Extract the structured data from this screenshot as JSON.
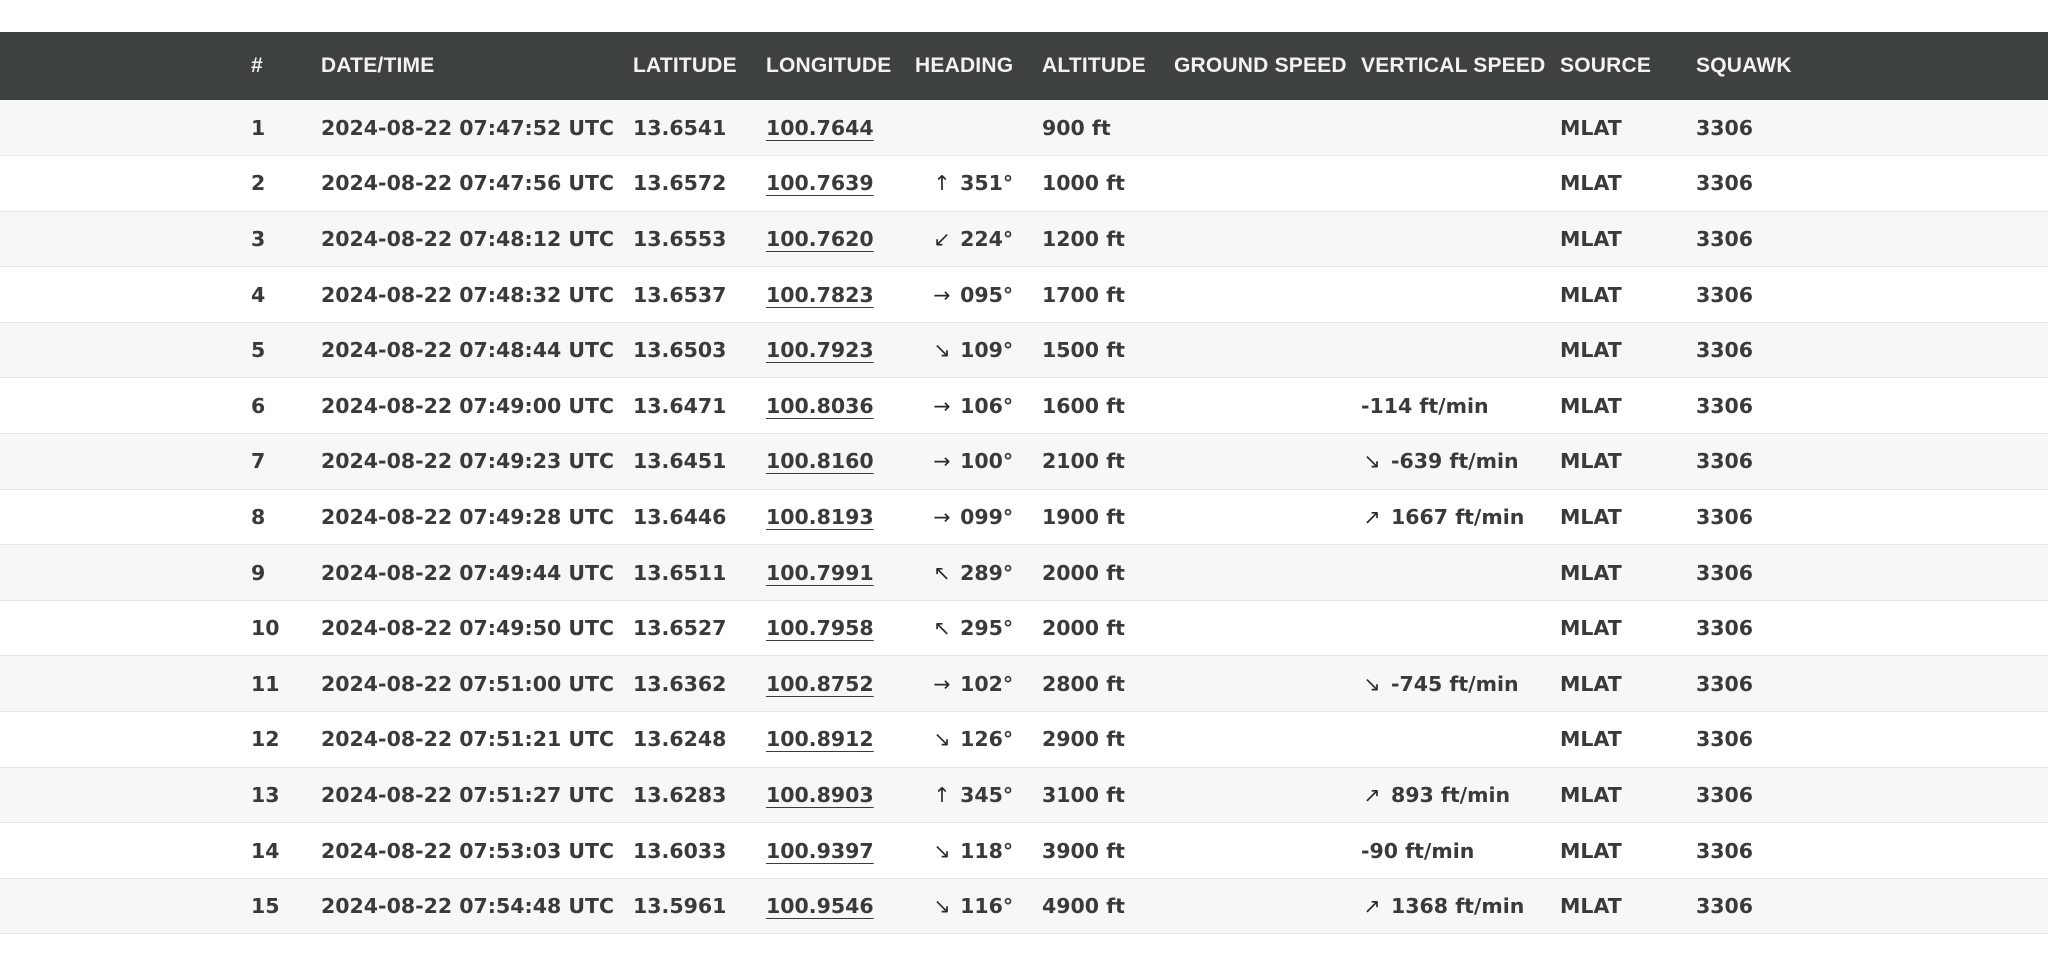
{
  "table": {
    "columns": [
      "#",
      "DATE/TIME",
      "LATITUDE",
      "LONGITUDE",
      "HEADING",
      "ALTITUDE",
      "GROUND SPEED",
      "VERTICAL SPEED",
      "SOURCE",
      "SQUAWK"
    ],
    "rows": [
      {
        "num": "1",
        "datetime": "2024-08-22 07:47:52 UTC",
        "lat": "13.6541",
        "lon": "100.7644",
        "heading_arrow": "",
        "heading": "",
        "altitude": "900 ft",
        "ground_speed": "",
        "vs_arrow": "",
        "vertical_speed": "",
        "source": "MLAT",
        "squawk": "3306"
      },
      {
        "num": "2",
        "datetime": "2024-08-22 07:47:56 UTC",
        "lat": "13.6572",
        "lon": "100.7639",
        "heading_arrow": "↑",
        "heading": "351°",
        "altitude": "1000 ft",
        "ground_speed": "",
        "vs_arrow": "",
        "vertical_speed": "",
        "source": "MLAT",
        "squawk": "3306"
      },
      {
        "num": "3",
        "datetime": "2024-08-22 07:48:12 UTC",
        "lat": "13.6553",
        "lon": "100.7620",
        "heading_arrow": "↙",
        "heading": "224°",
        "altitude": "1200 ft",
        "ground_speed": "",
        "vs_arrow": "",
        "vertical_speed": "",
        "source": "MLAT",
        "squawk": "3306"
      },
      {
        "num": "4",
        "datetime": "2024-08-22 07:48:32 UTC",
        "lat": "13.6537",
        "lon": "100.7823",
        "heading_arrow": "→",
        "heading": "095°",
        "altitude": "1700 ft",
        "ground_speed": "",
        "vs_arrow": "",
        "vertical_speed": "",
        "source": "MLAT",
        "squawk": "3306"
      },
      {
        "num": "5",
        "datetime": "2024-08-22 07:48:44 UTC",
        "lat": "13.6503",
        "lon": "100.7923",
        "heading_arrow": "↘",
        "heading": "109°",
        "altitude": "1500 ft",
        "ground_speed": "",
        "vs_arrow": "",
        "vertical_speed": "",
        "source": "MLAT",
        "squawk": "3306"
      },
      {
        "num": "6",
        "datetime": "2024-08-22 07:49:00 UTC",
        "lat": "13.6471",
        "lon": "100.8036",
        "heading_arrow": "→",
        "heading": "106°",
        "altitude": "1600 ft",
        "ground_speed": "",
        "vs_arrow": "",
        "vertical_speed": "-114 ft/min",
        "source": "MLAT",
        "squawk": "3306"
      },
      {
        "num": "7",
        "datetime": "2024-08-22 07:49:23 UTC",
        "lat": "13.6451",
        "lon": "100.8160",
        "heading_arrow": "→",
        "heading": "100°",
        "altitude": "2100 ft",
        "ground_speed": "",
        "vs_arrow": "↘",
        "vertical_speed": "-639 ft/min",
        "source": "MLAT",
        "squawk": "3306"
      },
      {
        "num": "8",
        "datetime": "2024-08-22 07:49:28 UTC",
        "lat": "13.6446",
        "lon": "100.8193",
        "heading_arrow": "→",
        "heading": "099°",
        "altitude": "1900 ft",
        "ground_speed": "",
        "vs_arrow": "↗",
        "vertical_speed": "1667 ft/min",
        "source": "MLAT",
        "squawk": "3306"
      },
      {
        "num": "9",
        "datetime": "2024-08-22 07:49:44 UTC",
        "lat": "13.6511",
        "lon": "100.7991",
        "heading_arrow": "↖",
        "heading": "289°",
        "altitude": "2000 ft",
        "ground_speed": "",
        "vs_arrow": "",
        "vertical_speed": "",
        "source": "MLAT",
        "squawk": "3306"
      },
      {
        "num": "10",
        "datetime": "2024-08-22 07:49:50 UTC",
        "lat": "13.6527",
        "lon": "100.7958",
        "heading_arrow": "↖",
        "heading": "295°",
        "altitude": "2000 ft",
        "ground_speed": "",
        "vs_arrow": "",
        "vertical_speed": "",
        "source": "MLAT",
        "squawk": "3306"
      },
      {
        "num": "11",
        "datetime": "2024-08-22 07:51:00 UTC",
        "lat": "13.6362",
        "lon": "100.8752",
        "heading_arrow": "→",
        "heading": "102°",
        "altitude": "2800 ft",
        "ground_speed": "",
        "vs_arrow": "↘",
        "vertical_speed": "-745 ft/min",
        "source": "MLAT",
        "squawk": "3306"
      },
      {
        "num": "12",
        "datetime": "2024-08-22 07:51:21 UTC",
        "lat": "13.6248",
        "lon": "100.8912",
        "heading_arrow": "↘",
        "heading": "126°",
        "altitude": "2900 ft",
        "ground_speed": "",
        "vs_arrow": "",
        "vertical_speed": "",
        "source": "MLAT",
        "squawk": "3306"
      },
      {
        "num": "13",
        "datetime": "2024-08-22 07:51:27 UTC",
        "lat": "13.6283",
        "lon": "100.8903",
        "heading_arrow": "↑",
        "heading": "345°",
        "altitude": "3100 ft",
        "ground_speed": "",
        "vs_arrow": "↗",
        "vertical_speed": "893 ft/min",
        "source": "MLAT",
        "squawk": "3306"
      },
      {
        "num": "14",
        "datetime": "2024-08-22 07:53:03 UTC",
        "lat": "13.6033",
        "lon": "100.9397",
        "heading_arrow": "↘",
        "heading": "118°",
        "altitude": "3900 ft",
        "ground_speed": "",
        "vs_arrow": "",
        "vertical_speed": "-90 ft/min",
        "source": "MLAT",
        "squawk": "3306"
      },
      {
        "num": "15",
        "datetime": "2024-08-22 07:54:48 UTC",
        "lat": "13.5961",
        "lon": "100.9546",
        "heading_arrow": "↘",
        "heading": "116°",
        "altitude": "4900 ft",
        "ground_speed": "",
        "vs_arrow": "↗",
        "vertical_speed": "1368 ft/min",
        "source": "MLAT",
        "squawk": "3306"
      }
    ]
  },
  "colors": {
    "header_bg": "#3d4240",
    "header_text": "#f2f2f2",
    "row_odd": "#f7f7f7",
    "row_even": "#ffffff",
    "text": "#3a3a3a"
  }
}
